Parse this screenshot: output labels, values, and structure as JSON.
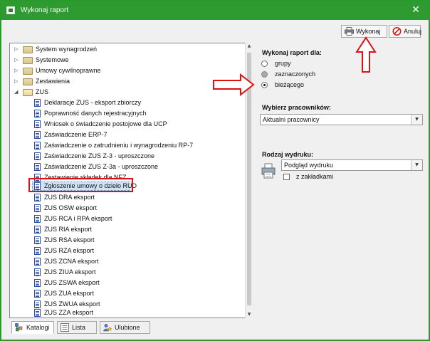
{
  "window": {
    "title": "Wykonaj raport",
    "close_glyph": "✕"
  },
  "toolbar": {
    "run_label": "Wykonaj",
    "run_icon": "printer-icon",
    "cancel_label": "Anuluj",
    "cancel_icon": "cancel-icon"
  },
  "tree": {
    "items": [
      {
        "label": "System wynagrodzeń",
        "type": "folder",
        "expanded": false
      },
      {
        "label": "Systemowe",
        "type": "folder",
        "expanded": false
      },
      {
        "label": "Umowy cywilnoprawne",
        "type": "folder",
        "expanded": false
      },
      {
        "label": "Zestawienia",
        "type": "folder",
        "expanded": false
      },
      {
        "label": "ZUS",
        "type": "folder",
        "expanded": true
      },
      {
        "label": "Deklaracje ZUS - eksport zbiorczy",
        "type": "report"
      },
      {
        "label": "Poprawność danych rejestracyjnych",
        "type": "report"
      },
      {
        "label": "Wniosek o świadczenie postojowe dla UCP",
        "type": "report"
      },
      {
        "label": "Zaświadczenie ERP-7",
        "type": "report"
      },
      {
        "label": "Zaświadczenie o zatrudnieniu i wynagrodzeniu RP-7",
        "type": "report"
      },
      {
        "label": "Zaświadczenie ZUS Z-3 - uproszczone",
        "type": "report"
      },
      {
        "label": "Zaświadczenie ZUS Z-3a - uproszczone",
        "type": "report"
      },
      {
        "label": "Zestawienie składek dla NFZ",
        "type": "report"
      },
      {
        "label": "Zgłoszenie umowy o dzieło RUD",
        "type": "report",
        "selected": true
      },
      {
        "label": "ZUS DRA eksport",
        "type": "report"
      },
      {
        "label": "ZUS OSW eksport",
        "type": "report"
      },
      {
        "label": "ZUS RCA i RPA eksport",
        "type": "report"
      },
      {
        "label": "ZUS RIA eksport",
        "type": "report"
      },
      {
        "label": "ZUS RSA eksport",
        "type": "report"
      },
      {
        "label": "ZUS RZA eksport",
        "type": "report"
      },
      {
        "label": "ZUS ZCNA eksport",
        "type": "report"
      },
      {
        "label": "ZUS ZIUA eksport",
        "type": "report"
      },
      {
        "label": "ZUS ZSWA eksport",
        "type": "report"
      },
      {
        "label": "ZUS ZUA eksport",
        "type": "report"
      },
      {
        "label": "ZUS ZWUA eksport",
        "type": "report"
      },
      {
        "label": "ZUS ZZA eksport",
        "type": "report"
      }
    ]
  },
  "tabs": [
    {
      "label": "Katalogi",
      "icon": "catalog-icon",
      "active": true
    },
    {
      "label": "Lista",
      "icon": "list-icon",
      "active": false
    },
    {
      "label": "Ulubione",
      "icon": "favorites-icon",
      "active": false
    }
  ],
  "report_for": {
    "title": "Wykonaj raport dla:",
    "options": [
      {
        "label": "grupy",
        "state": "unchecked"
      },
      {
        "label": "zaznaczonych",
        "state": "disabled"
      },
      {
        "label": "bieżącego",
        "state": "checked"
      }
    ]
  },
  "employees": {
    "title": "Wybierz pracowników:",
    "value": "Aktualni pracownicy"
  },
  "output": {
    "title": "Rodzaj wydruku:",
    "value": "Podgląd wydruku",
    "bookmarks_label": "z zakładkami",
    "bookmarks_checked": false
  },
  "colors": {
    "titlebar": "#2e9b31",
    "annotation": "#e01010",
    "selection": "#cfe3f7"
  }
}
